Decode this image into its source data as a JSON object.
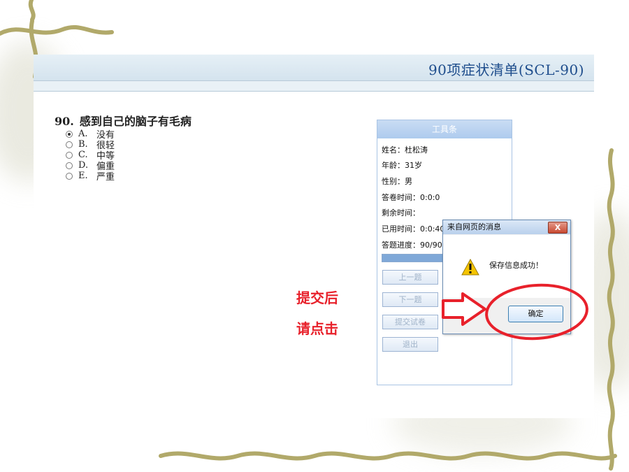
{
  "header": {
    "title": "90项症状清单(SCL-90)"
  },
  "question": {
    "number": "90.",
    "text": "感到自己的脑子有毛病",
    "options": [
      {
        "letter": "A.",
        "label": "没有",
        "checked": true
      },
      {
        "letter": "B.",
        "label": "很轻",
        "checked": false
      },
      {
        "letter": "C.",
        "label": "中等",
        "checked": false
      },
      {
        "letter": "D.",
        "label": "偏重",
        "checked": false
      },
      {
        "letter": "E.",
        "label": "严重",
        "checked": false
      }
    ]
  },
  "toolbar": {
    "title": "工具条",
    "name": "姓名：杜松涛",
    "age": "年龄：31岁",
    "gender": "性别：男",
    "answer_time": "答卷时间：0:0:0",
    "remaining_time": "剩余时间：",
    "used_time": "已用时间：0:0:40",
    "progress_text": "答题进度：90/90",
    "progress_value": 1.0,
    "buttons": {
      "prev": "上一题",
      "next": "下一题",
      "submit": "提交试卷",
      "exit": "退出"
    }
  },
  "dialog": {
    "title": "来自网页的消息",
    "close": "X",
    "message": "保存信息成功！",
    "ok": "确定"
  },
  "annotation": {
    "line1": "提交后",
    "line2": "请点击",
    "color": "#e8212b"
  }
}
